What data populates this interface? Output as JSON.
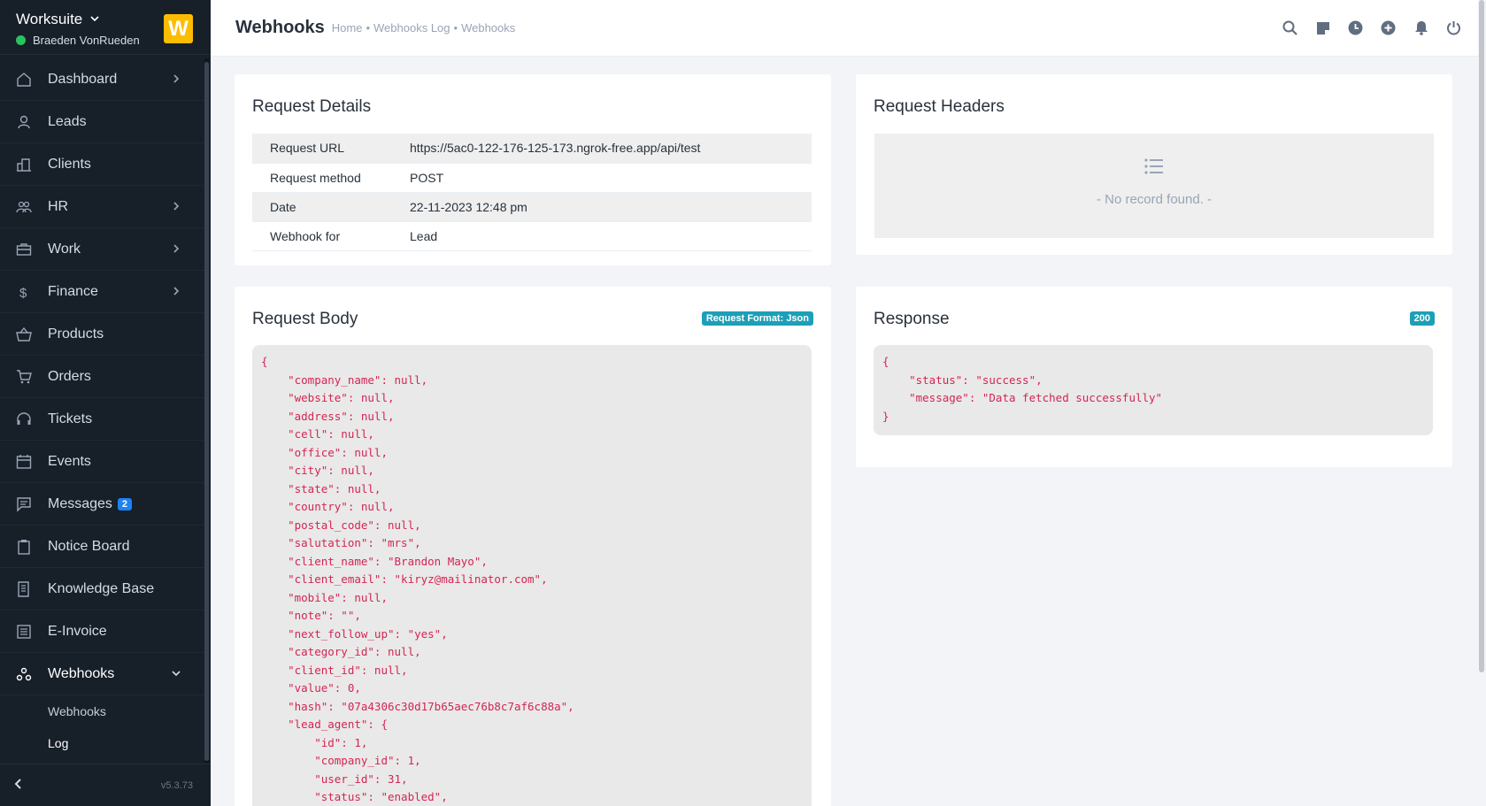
{
  "sidebar": {
    "app_name": "Worksuite",
    "user_name": "Braeden VonRueden",
    "logo_letter": "W",
    "items": [
      {
        "label": "Dashboard",
        "icon": "home-icon",
        "has_arrow": true
      },
      {
        "label": "Leads",
        "icon": "user-icon",
        "has_arrow": false
      },
      {
        "label": "Clients",
        "icon": "building-icon",
        "has_arrow": false
      },
      {
        "label": "HR",
        "icon": "people-icon",
        "has_arrow": true
      },
      {
        "label": "Work",
        "icon": "briefcase-icon",
        "has_arrow": true
      },
      {
        "label": "Finance",
        "icon": "dollar-icon",
        "has_arrow": true
      },
      {
        "label": "Products",
        "icon": "basket-icon",
        "has_arrow": false
      },
      {
        "label": "Orders",
        "icon": "cart-icon",
        "has_arrow": false
      },
      {
        "label": "Tickets",
        "icon": "headset-icon",
        "has_arrow": false
      },
      {
        "label": "Events",
        "icon": "calendar-icon",
        "has_arrow": false
      },
      {
        "label": "Messages",
        "icon": "chat-icon",
        "has_arrow": false,
        "badge": "2"
      },
      {
        "label": "Notice Board",
        "icon": "clipboard-icon",
        "has_arrow": false
      },
      {
        "label": "Knowledge Base",
        "icon": "book-icon",
        "has_arrow": false
      },
      {
        "label": "E-Invoice",
        "icon": "receipt-icon",
        "has_arrow": false
      },
      {
        "label": "Webhooks",
        "icon": "webhook-icon",
        "has_arrow": true,
        "expanded": true
      }
    ],
    "sub_items": [
      "Webhooks",
      "Log"
    ],
    "version": "v5.3.73"
  },
  "header": {
    "title": "Webhooks",
    "breadcrumb": [
      "Home",
      "•",
      "Webhooks Log",
      "•",
      "Webhooks"
    ]
  },
  "request_details": {
    "title": "Request Details",
    "rows": [
      {
        "key": "Request URL",
        "value": "https://5ac0-122-176-125-173.ngrok-free.app/api/test"
      },
      {
        "key": "Request method",
        "value": "POST"
      },
      {
        "key": "Date",
        "value": "22-11-2023 12:48 pm"
      },
      {
        "key": "Webhook for",
        "value": "Lead"
      }
    ]
  },
  "request_headers": {
    "title": "Request Headers",
    "empty_text": "- No record found. -"
  },
  "request_body": {
    "title": "Request Body",
    "format_tag": "Request Format: Json",
    "code": "{\n    \"company_name\": null,\n    \"website\": null,\n    \"address\": null,\n    \"cell\": null,\n    \"office\": null,\n    \"city\": null,\n    \"state\": null,\n    \"country\": null,\n    \"postal_code\": null,\n    \"salutation\": \"mrs\",\n    \"client_name\": \"Brandon Mayo\",\n    \"client_email\": \"kiryz@mailinator.com\",\n    \"mobile\": null,\n    \"note\": \"\",\n    \"next_follow_up\": \"yes\",\n    \"category_id\": null,\n    \"client_id\": null,\n    \"value\": 0,\n    \"hash\": \"07a4306c30d17b65aec76b8c7af6c88a\",\n    \"lead_agent\": {\n        \"id\": 1,\n        \"company_id\": 1,\n        \"user_id\": 31,\n        \"status\": \"enabled\","
  },
  "response": {
    "title": "Response",
    "status_tag": "200",
    "code": "{\n    \"status\": \"success\",\n    \"message\": \"Data fetched successfully\"\n}"
  }
}
